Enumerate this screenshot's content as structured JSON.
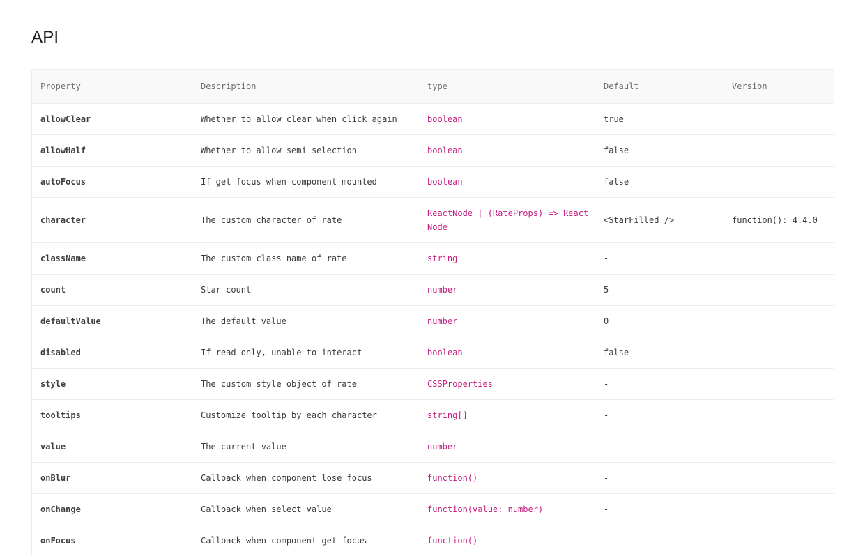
{
  "title": "API",
  "table": {
    "headers": [
      "Property",
      "Description",
      "type",
      "Default",
      "Version"
    ],
    "rows": [
      {
        "property": "allowClear",
        "description": "Whether to allow clear when click again",
        "type": "boolean",
        "default": "true",
        "version": ""
      },
      {
        "property": "allowHalf",
        "description": "Whether to allow semi selection",
        "type": "boolean",
        "default": "false",
        "version": ""
      },
      {
        "property": "autoFocus",
        "description": "If get focus when component mounted",
        "type": "boolean",
        "default": "false",
        "version": ""
      },
      {
        "property": "character",
        "description": "The custom character of rate",
        "type": "ReactNode | (RateProps) => React Node",
        "default": "<StarFilled />",
        "version": "function(): 4.4.0"
      },
      {
        "property": "className",
        "description": "The custom class name of rate",
        "type": "string",
        "default": "-",
        "version": ""
      },
      {
        "property": "count",
        "description": "Star count",
        "type": "number",
        "default": "5",
        "version": ""
      },
      {
        "property": "defaultValue",
        "description": "The default value",
        "type": "number",
        "default": "0",
        "version": ""
      },
      {
        "property": "disabled",
        "description": "If read only, unable to interact",
        "type": "boolean",
        "default": "false",
        "version": ""
      },
      {
        "property": "style",
        "description": "The custom style object of rate",
        "type": "CSSProperties",
        "default": "-",
        "version": ""
      },
      {
        "property": "tooltips",
        "description": "Customize tooltip by each character",
        "type": "string[]",
        "default": "-",
        "version": ""
      },
      {
        "property": "value",
        "description": "The current value",
        "type": "number",
        "default": "-",
        "version": ""
      },
      {
        "property": "onBlur",
        "description": "Callback when component lose focus",
        "type": "function()",
        "default": "-",
        "version": ""
      },
      {
        "property": "onChange",
        "description": "Callback when select value",
        "type": "function(value: number)",
        "default": "-",
        "version": ""
      },
      {
        "property": "onFocus",
        "description": "Callback when component get focus",
        "type": "function()",
        "default": "-",
        "version": ""
      }
    ]
  }
}
